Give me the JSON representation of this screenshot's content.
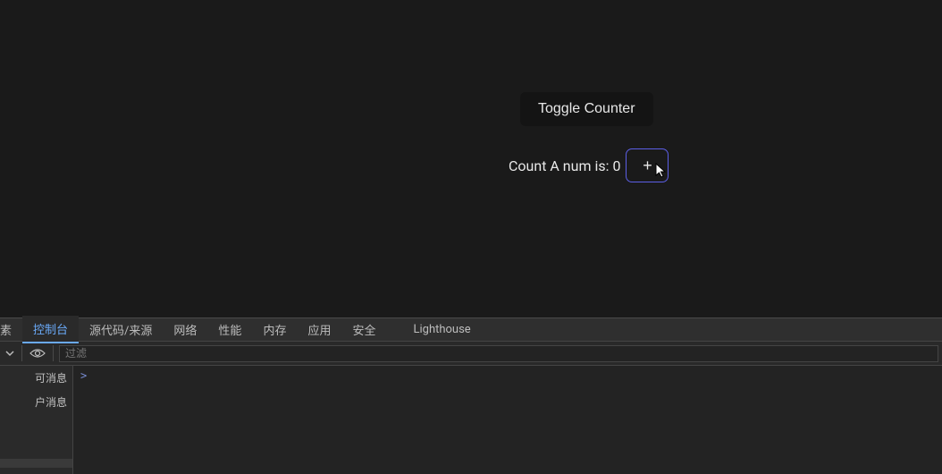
{
  "app": {
    "toggle_label": "Toggle Counter",
    "counter_text": "Count A num is: 0",
    "plus_label": "+"
  },
  "devtools": {
    "tabs": {
      "elements_partial": "素",
      "console": "控制台",
      "sources": "源代码/来源",
      "network": "网络",
      "performance": "性能",
      "memory": "内存",
      "application": "应用",
      "security": "安全",
      "lighthouse": "Lighthouse"
    },
    "filter_placeholder": "过滤",
    "sidebar": {
      "item1": "可消息",
      "item2": "户消息"
    },
    "prompt": ">"
  }
}
